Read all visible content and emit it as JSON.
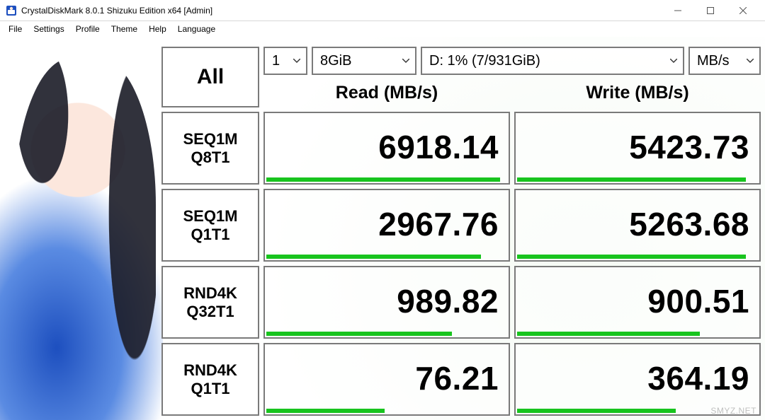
{
  "window": {
    "title": "CrystalDiskMark 8.0.1 Shizuku Edition x64 [Admin]"
  },
  "menu": {
    "file": "File",
    "settings": "Settings",
    "profile": "Profile",
    "theme": "Theme",
    "help": "Help",
    "language": "Language"
  },
  "controls": {
    "all": "All",
    "test_count": "1",
    "test_size": "8GiB",
    "drive": "D: 1% (7/931GiB)",
    "unit": "MB/s"
  },
  "headers": {
    "read": "Read (MB/s)",
    "write": "Write (MB/s)"
  },
  "tests": [
    {
      "label1": "SEQ1M",
      "label2": "Q8T1",
      "read": "6918.14",
      "write": "5423.73",
      "read_pct": 97,
      "write_pct": 95
    },
    {
      "label1": "SEQ1M",
      "label2": "Q1T1",
      "read": "2967.76",
      "write": "5263.68",
      "read_pct": 89,
      "write_pct": 95
    },
    {
      "label1": "RND4K",
      "label2": "Q32T1",
      "read": "989.82",
      "write": "900.51",
      "read_pct": 77,
      "write_pct": 76
    },
    {
      "label1": "RND4K",
      "label2": "Q1T1",
      "read": "76.21",
      "write": "364.19",
      "read_pct": 49,
      "write_pct": 66
    }
  ],
  "watermark": "SMYZ.NET"
}
